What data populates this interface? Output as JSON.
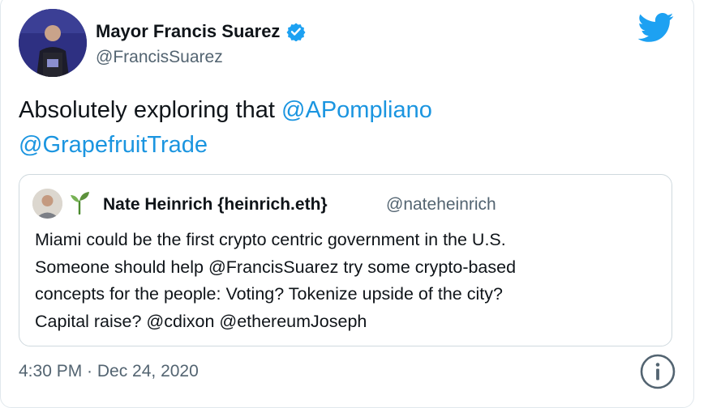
{
  "tweet": {
    "author_name": "Mayor Francis Suarez",
    "author_handle": "@FrancisSuarez",
    "text_prefix": "Absolutely exploring that ",
    "mention_1": "@APompliano",
    "mention_2": "@GrapefruitTrade",
    "timestamp": "4:30 PM · Dec 24, 2020"
  },
  "quoted_tweet": {
    "author_name": "Nate Heinrich {heinrich.eth}",
    "author_handle": "@nateheinrich",
    "lines": [
      "Miami could be the first crypto centric government in the U.S.",
      "Someone should help @FrancisSuarez try some crypto-based",
      "concepts for the people: Voting? Tokenize upside of the city?",
      "Capital raise? @cdixon @ethereumJoseph"
    ]
  },
  "colors": {
    "link": "#1b95e0",
    "twitter_blue": "#1da1f2",
    "muted_text": "#536471"
  },
  "icons": [
    "verified-badge-icon",
    "twitter-bird-icon",
    "sprout-icon",
    "info-icon"
  ]
}
